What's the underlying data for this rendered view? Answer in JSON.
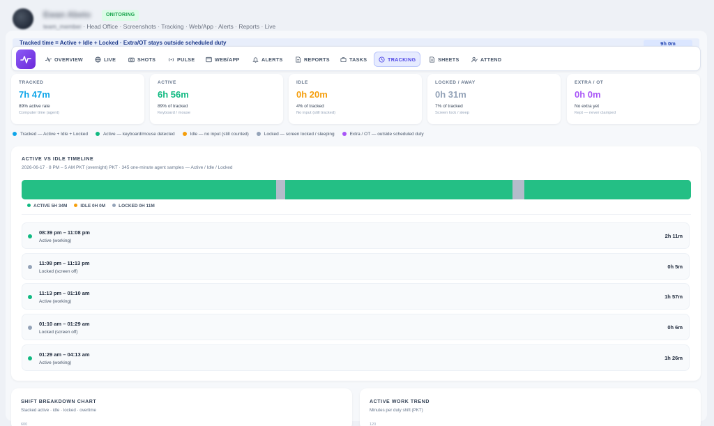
{
  "header": {
    "user_name": "Ewan Abeto",
    "badge": "ONITORING",
    "user_role": "team_member",
    "sub_links": "· Head Office · Screenshots · Tracking · Web/App · Alerts · Reports · Live"
  },
  "banner": {
    "text": "Tracked time = Active + Idle + Locked · Extra/OT stays outside scheduled duty",
    "pill": "9h 0m"
  },
  "nav": {
    "tabs": [
      {
        "label": "OVERVIEW",
        "icon": "pulse-icon"
      },
      {
        "label": "LIVE",
        "icon": "globe-icon"
      },
      {
        "label": "SHOTS",
        "icon": "camera-icon"
      },
      {
        "label": "PULSE",
        "icon": "broadcast-icon"
      },
      {
        "label": "WEB/APP",
        "icon": "window-icon"
      },
      {
        "label": "ALERTS",
        "icon": "bell-icon"
      },
      {
        "label": "REPORTS",
        "icon": "document-icon"
      },
      {
        "label": "TASKS",
        "icon": "briefcase-icon"
      },
      {
        "label": "TRACKING",
        "icon": "clock-icon"
      },
      {
        "label": "SHEETS",
        "icon": "sheet-icon"
      },
      {
        "label": "ATTEND",
        "icon": "user-check-icon"
      }
    ],
    "active_tab": "TRACKING"
  },
  "stats": [
    {
      "label": "TRACKED",
      "value": "7h 47m",
      "sub1": "89% active rate",
      "sub2": "Computer time (agent)",
      "color": "#0ea5e9"
    },
    {
      "label": "ACTIVE",
      "value": "6h 56m",
      "sub1": "89% of tracked",
      "sub2": "Keyboard / mouse",
      "color": "#10b981"
    },
    {
      "label": "IDLE",
      "value": "0h 20m",
      "sub1": "4% of tracked",
      "sub2": "No input (still tracked)",
      "color": "#f59e0b"
    },
    {
      "label": "LOCKED / AWAY",
      "value": "0h 31m",
      "sub1": "7% of tracked",
      "sub2": "Screen lock / sleep",
      "color": "#94a3b8"
    },
    {
      "label": "EXTRA / OT",
      "value": "0h 0m",
      "sub1": "No extra yet",
      "sub2": "Kept — never clamped",
      "color": "#a855f7"
    }
  ],
  "legend": [
    {
      "label": "Tracked — Active + Idle + Locked",
      "color": "#0ea5e9"
    },
    {
      "label": "Active — keyboard/mouse detected",
      "color": "#10b981"
    },
    {
      "label": "Idle — no input (still counted)",
      "color": "#f59e0b"
    },
    {
      "label": "Locked — screen locked / sleeping",
      "color": "#94a3b8"
    },
    {
      "label": "Extra / OT — outside scheduled duty",
      "color": "#a855f7"
    }
  ],
  "timeline": {
    "title": "ACTIVE VS IDLE TIMELINE",
    "subtitle": "2026-06-17 · 8 PM – 5 AM PKT (overnight) PKT · 345 one-minute agent samples — Active / Idle / Locked",
    "total_minutes": 345,
    "bar_segments": [
      {
        "state": "active",
        "start_min": 0,
        "minutes": 131
      },
      {
        "state": "locked",
        "start_min": 131,
        "minutes": 5
      },
      {
        "state": "active",
        "start_min": 136,
        "minutes": 117
      },
      {
        "state": "locked",
        "start_min": 253,
        "minutes": 6
      },
      {
        "state": "active",
        "start_min": 259,
        "minutes": 86
      }
    ],
    "state_colors": {
      "active": "#24bf85",
      "idle": "#f59e0b",
      "locked": "#b4bccb"
    },
    "summary": [
      {
        "label": "ACTIVE 5H 34M",
        "color": "#10b981"
      },
      {
        "label": "IDLE 0H 0M",
        "color": "#f59e0b"
      },
      {
        "label": "LOCKED 0H 11M",
        "color": "#94a3b8"
      }
    ],
    "rows": [
      {
        "range": "08:39 pm – 11:08 pm",
        "state": "Active (working)",
        "duration": "2h 11m",
        "color": "#10b981"
      },
      {
        "range": "11:08 pm – 11:13 pm",
        "state": "Locked (screen off)",
        "duration": "0h 5m",
        "color": "#94a3b8"
      },
      {
        "range": "11:13 pm – 01:10 am",
        "state": "Active (working)",
        "duration": "1h 57m",
        "color": "#10b981"
      },
      {
        "range": "01:10 am – 01:29 am",
        "state": "Locked (screen off)",
        "duration": "0h 6m",
        "color": "#94a3b8"
      },
      {
        "range": "01:29 am – 04:13 am",
        "state": "Active (working)",
        "duration": "1h 26m",
        "color": "#10b981"
      }
    ]
  },
  "shift_chart": {
    "title": "SHIFT BREAKDOWN CHART",
    "subtitle": "Stacked active · idle · locked · overtime",
    "tick": "600"
  },
  "trend_chart": {
    "title": "ACTIVE WORK TREND",
    "subtitle": "Minutes per duty shift (PKT)",
    "tick": "120"
  }
}
